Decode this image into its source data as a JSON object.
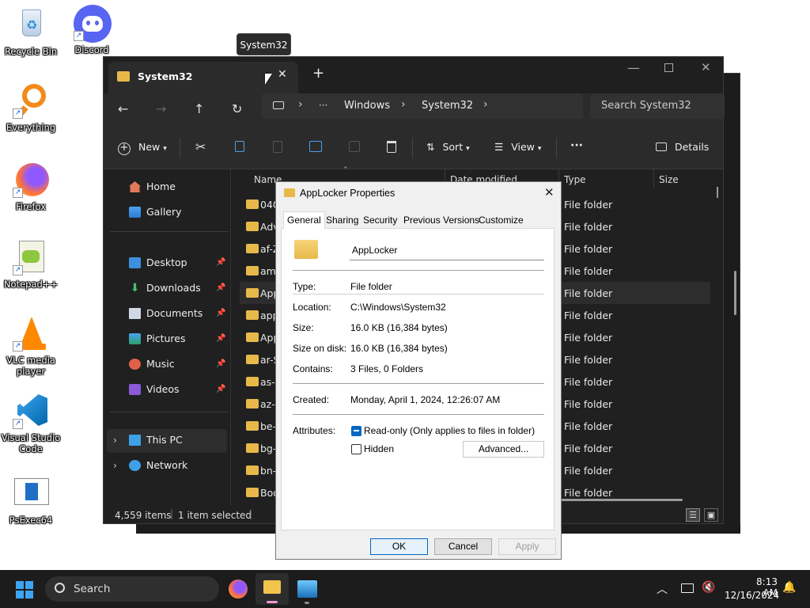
{
  "desktop": {
    "icons": [
      {
        "label": "Recycle Bin"
      },
      {
        "label": "Discord"
      },
      {
        "label": "Everything"
      },
      {
        "label": "Firefox"
      },
      {
        "label": "Notepad++"
      },
      {
        "label": "VLC media player"
      },
      {
        "label": "Visual Studio Code"
      },
      {
        "label": "PsExec64"
      }
    ]
  },
  "tooltip": "System32",
  "explorer": {
    "tab_title": "System32",
    "new_tab": "+",
    "breadcrumb": [
      "Windows",
      "System32"
    ],
    "breadcrumb_more": "···",
    "search_placeholder": "Search System32",
    "toolbar": {
      "new": "New",
      "sort": "Sort",
      "view": "View",
      "more": "···",
      "details": "Details"
    },
    "columns": {
      "name": "Name",
      "date": "Date modified",
      "type": "Type",
      "size": "Size"
    },
    "sidebar": {
      "home": "Home",
      "gallery": "Gallery",
      "desktop": "Desktop",
      "downloads": "Downloads",
      "documents": "Documents",
      "pictures": "Pictures",
      "music": "Music",
      "videos": "Videos",
      "this_pc": "This PC",
      "network": "Network"
    },
    "rows": [
      {
        "name": "0409",
        "type": "File folder"
      },
      {
        "name": "Adv",
        "type": "File folder"
      },
      {
        "name": "af-Z",
        "type": "File folder"
      },
      {
        "name": "am-",
        "type": "File folder"
      },
      {
        "name": "App",
        "type": "File folder"
      },
      {
        "name": "app",
        "type": "File folder"
      },
      {
        "name": "App",
        "type": "File folder"
      },
      {
        "name": "ar-S",
        "type": "File folder"
      },
      {
        "name": "as-I",
        "type": "File folder"
      },
      {
        "name": "az-L",
        "type": "File folder"
      },
      {
        "name": "be-I",
        "type": "File folder"
      },
      {
        "name": "bg-I",
        "type": "File folder"
      },
      {
        "name": "bn-I",
        "type": "File folder"
      },
      {
        "name": "Boo",
        "type": "File folder"
      }
    ],
    "status": {
      "items": "4,559 items",
      "selected": "1 item selected"
    }
  },
  "dialog": {
    "title": "AppLocker Properties",
    "tabs": [
      "General",
      "Sharing",
      "Security",
      "Previous Versions",
      "Customize"
    ],
    "name_value": "AppLocker",
    "type_label": "Type:",
    "type_value": "File folder",
    "location_label": "Location:",
    "location_value": "C:\\Windows\\System32",
    "size_label": "Size:",
    "size_value": "16.0 KB (16,384 bytes)",
    "size_disk_label": "Size on disk:",
    "size_disk_value": "16.0 KB (16,384 bytes)",
    "contains_label": "Contains:",
    "contains_value": "3 Files, 0 Folders",
    "created_label": "Created:",
    "created_value": "Monday, April 1, 2024, 12:26:07 AM",
    "attributes_label": "Attributes:",
    "readonly_label": "Read-only (Only applies to files in folder)",
    "hidden_label": "Hidden",
    "advanced_button": "Advanced...",
    "ok": "OK",
    "cancel": "Cancel",
    "apply": "Apply"
  },
  "taskbar": {
    "search_placeholder": "Search",
    "time": "8:13 AM",
    "date": "12/16/2024"
  },
  "colors": {
    "accent": "#0067c0",
    "folder": "#e8b94a",
    "dark_bg": "#202020"
  }
}
